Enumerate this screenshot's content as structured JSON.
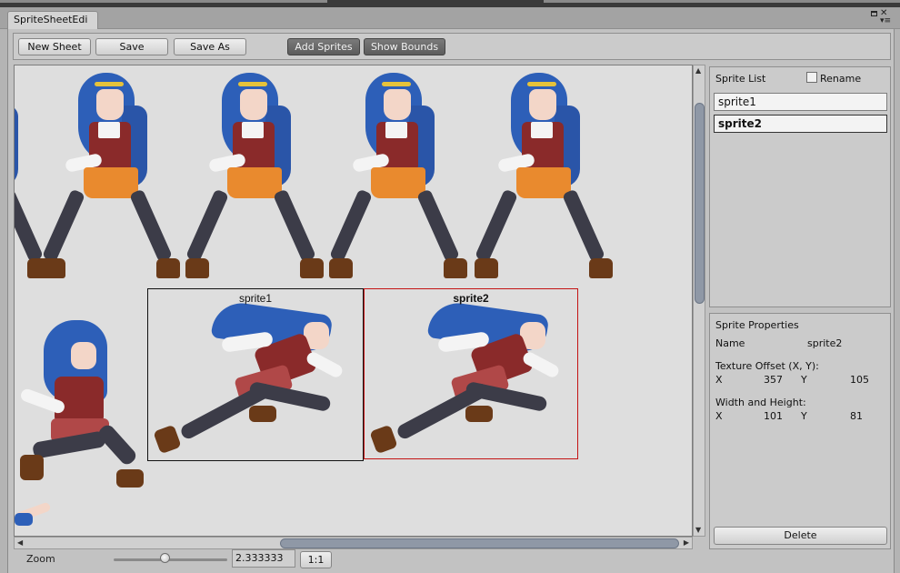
{
  "window": {
    "tab_title": "SpriteSheetEdi"
  },
  "toolbar": {
    "new_sheet": "New Sheet",
    "save": "Save",
    "save_as": "Save As",
    "add_sprites": "Add Sprites",
    "show_bounds": "Show Bounds"
  },
  "canvas": {
    "bounds": [
      {
        "label": "sprite1",
        "selected": false
      },
      {
        "label": "sprite2",
        "selected": true
      }
    ]
  },
  "scrollbars": {
    "vertical_position": 0.06,
    "vertical_visible": 0.45,
    "horizontal_position": 0.39,
    "horizontal_visible": 0.61
  },
  "statusbar": {
    "zoom_label": "Zoom",
    "zoom_value": "2.333333",
    "zoom_slider": 0.45,
    "reset_button": "1:1"
  },
  "sprite_list": {
    "title": "Sprite List",
    "rename_label": "Rename",
    "rename_checked": false,
    "items": [
      {
        "name": "sprite1",
        "selected": false
      },
      {
        "name": "sprite2",
        "selected": true
      }
    ]
  },
  "sprite_properties": {
    "title": "Sprite Properties",
    "name_label": "Name",
    "name_value": "sprite2",
    "texture_offset_label": "Texture Offset (X, Y):",
    "offset_x_label": "X",
    "offset_x": "357",
    "offset_y_label": "Y",
    "offset_y": "105",
    "size_label": "Width and Height:",
    "width_label": "X",
    "width": "101",
    "height_label": "Y",
    "height": "81",
    "delete_button": "Delete"
  }
}
